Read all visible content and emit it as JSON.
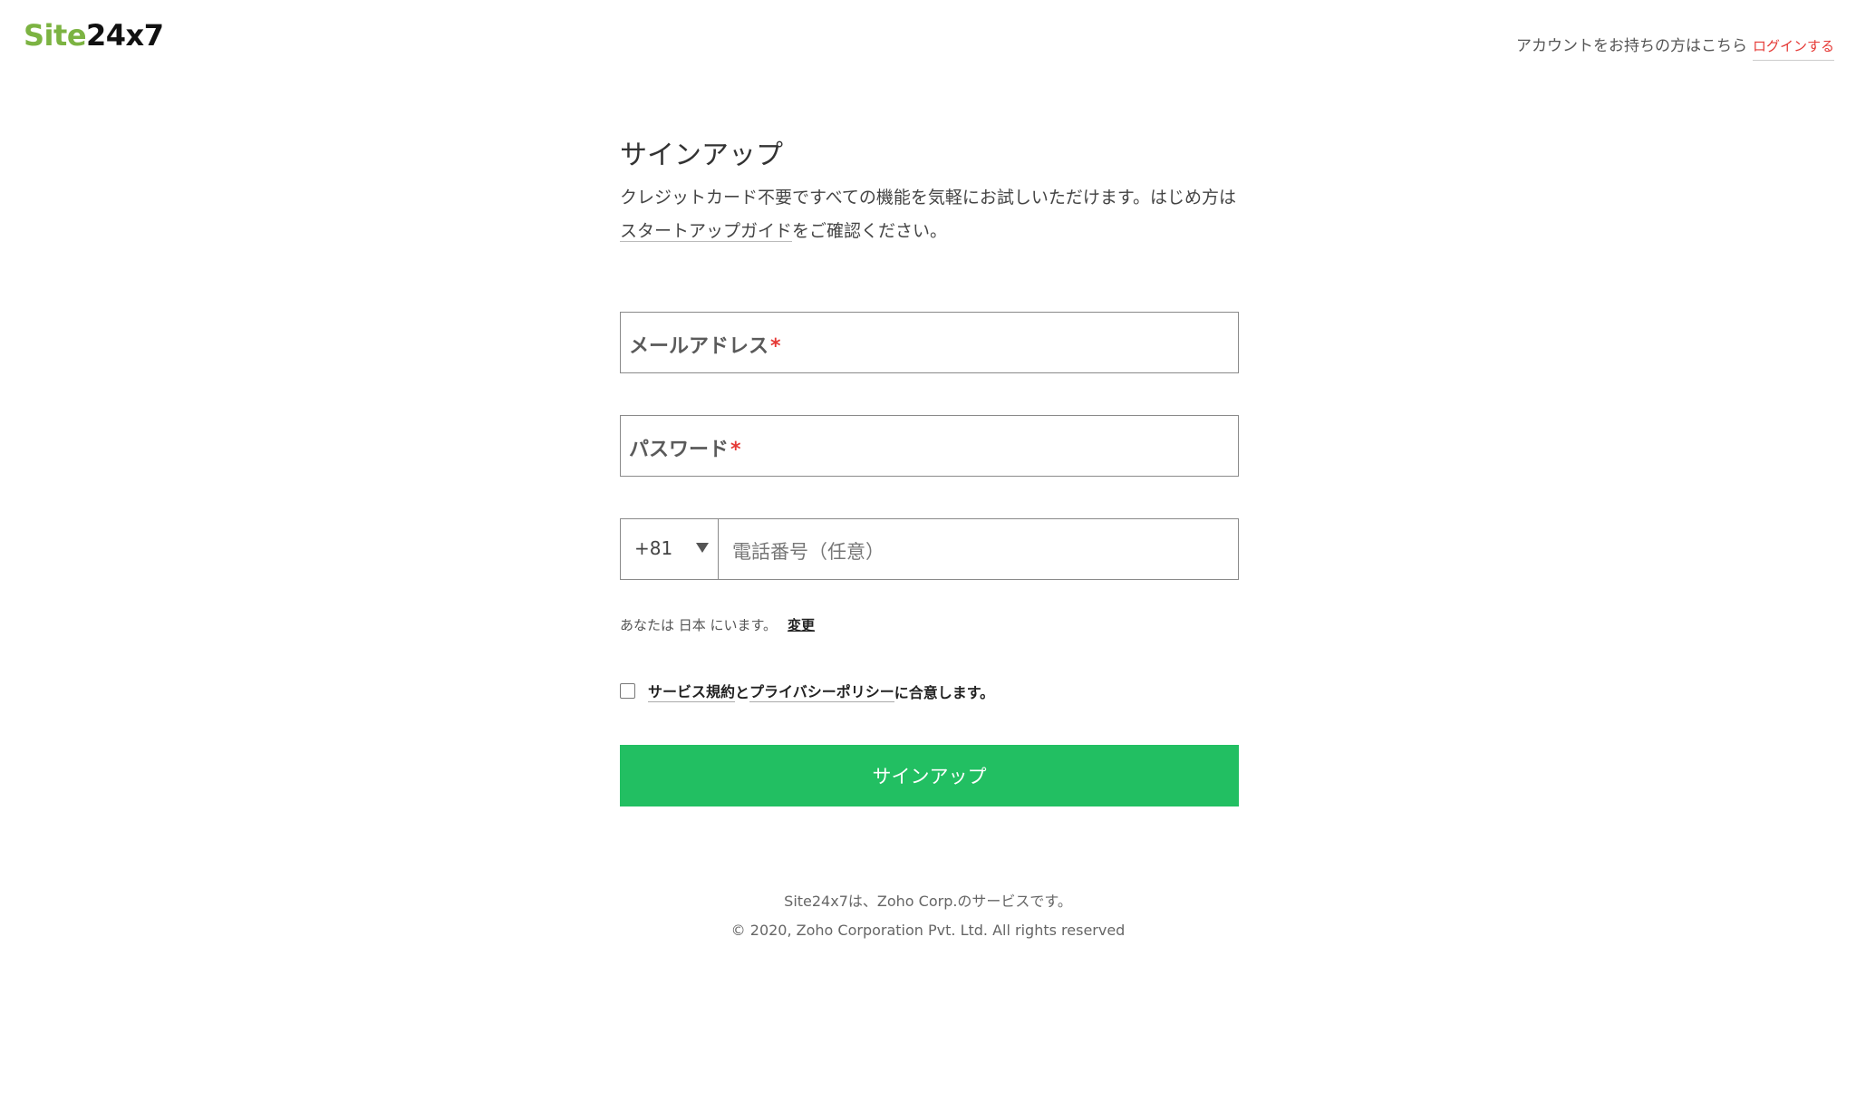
{
  "header": {
    "logo_site": "Site",
    "logo_num": "24x7",
    "account_prompt": "アカウントをお持ちの方はこちら",
    "login_link": "ログインする"
  },
  "form": {
    "title": "サインアップ",
    "description_before": "クレジットカード不要ですべての機能を気軽にお試しいただけます。はじめ方は",
    "description_link": "スタートアップガイド",
    "description_after": "をご確認ください。",
    "email_label": "メールアドレス",
    "password_label": "パスワード",
    "required_mark": "*",
    "country_code": "+81",
    "phone_placeholder": "電話番号（任意）",
    "location_text": "あなたは 日本 にいます。",
    "location_change": "変更",
    "agree_terms_link": "サービス規約",
    "agree_and": "と",
    "agree_privacy_link": "プライバシーポリシー",
    "agree_suffix": "に合意します。",
    "submit_label": "サインアップ"
  },
  "footer": {
    "service_note": "Site24x7は、Zoho Corp.のサービスです。",
    "copyright": "© 2020, Zoho Corporation Pvt. Ltd. All rights reserved"
  },
  "colors": {
    "brand_green": "#7cb342",
    "button_green": "#22bf62",
    "required_red": "#e53935"
  }
}
